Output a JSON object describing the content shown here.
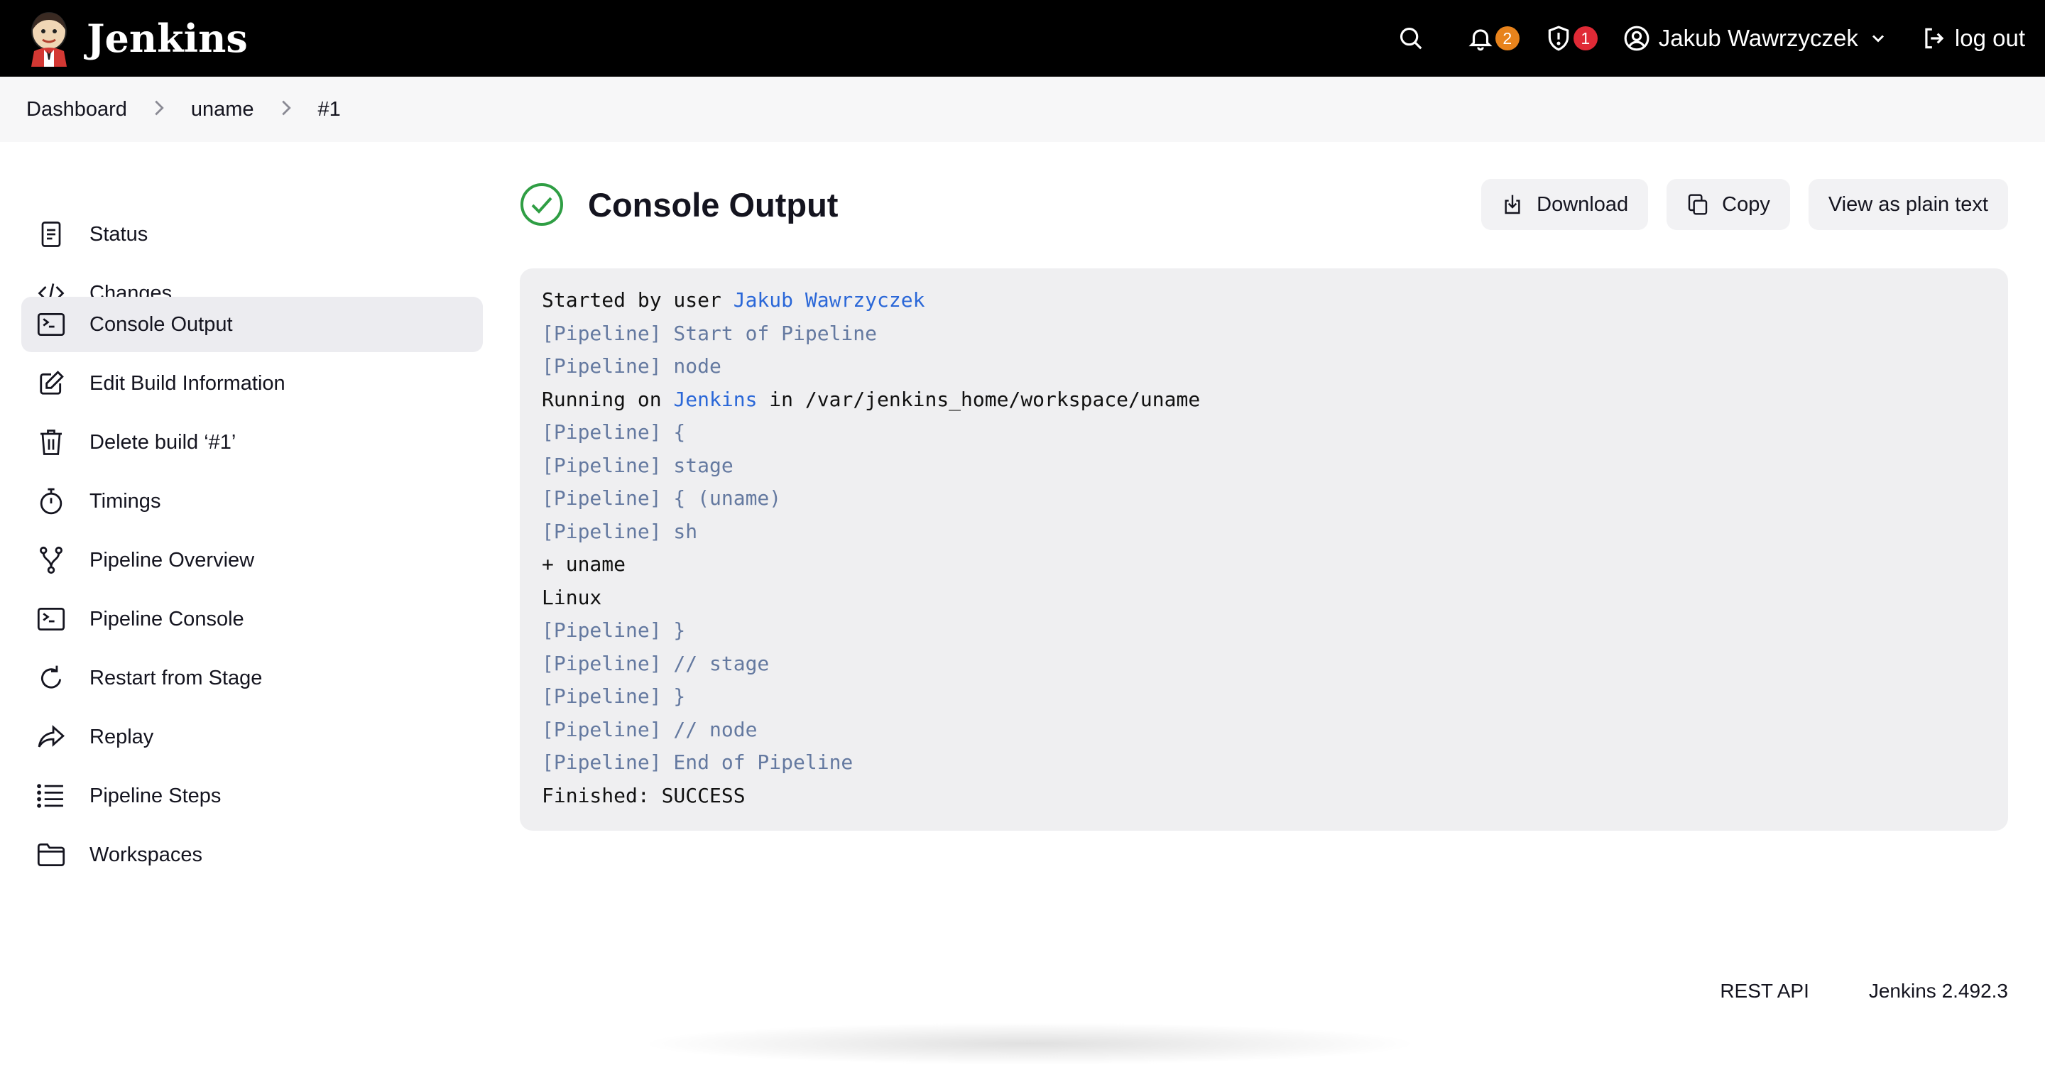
{
  "header": {
    "app_name": "Jenkins",
    "notifications_count": "2",
    "security_count": "1",
    "user_name": "Jakub Wawrzyczek",
    "logout_label": "log out"
  },
  "breadcrumb": [
    "Dashboard",
    "uname",
    "#1"
  ],
  "sidebar": {
    "items": [
      {
        "label": "Status",
        "icon": "document-icon"
      },
      {
        "label": "Changes",
        "icon": "code-icon"
      },
      {
        "label": "Console Output",
        "icon": "terminal-icon",
        "active": true
      },
      {
        "label": "Edit Build Information",
        "icon": "edit-icon"
      },
      {
        "label": "Delete build ‘#1’",
        "icon": "trash-icon"
      },
      {
        "label": "Timings",
        "icon": "stopwatch-icon"
      },
      {
        "label": "Pipeline Overview",
        "icon": "branch-icon"
      },
      {
        "label": "Pipeline Console",
        "icon": "terminal-icon"
      },
      {
        "label": "Restart from Stage",
        "icon": "refresh-icon"
      },
      {
        "label": "Replay",
        "icon": "share-arrow-icon"
      },
      {
        "label": "Pipeline Steps",
        "icon": "list-icon"
      },
      {
        "label": "Workspaces",
        "icon": "folder-icon"
      }
    ]
  },
  "main": {
    "title": "Console Output",
    "status_icon": "success-check-icon",
    "actions": {
      "download": "Download",
      "copy": "Copy",
      "plain_text": "View as plain text"
    },
    "console_lines": [
      {
        "segments": [
          {
            "text": "Started by user ",
            "style": "plain"
          },
          {
            "text": "Jakub Wawrzyczek",
            "style": "link"
          }
        ]
      },
      {
        "segments": [
          {
            "text": "[Pipeline] Start of Pipeline",
            "style": "pipe"
          }
        ]
      },
      {
        "segments": [
          {
            "text": "[Pipeline] node",
            "style": "pipe"
          }
        ]
      },
      {
        "segments": [
          {
            "text": "Running on ",
            "style": "plain"
          },
          {
            "text": "Jenkins",
            "style": "link"
          },
          {
            "text": " in /var/jenkins_home/workspace/uname",
            "style": "plain"
          }
        ]
      },
      {
        "segments": [
          {
            "text": "[Pipeline] {",
            "style": "pipe"
          }
        ]
      },
      {
        "segments": [
          {
            "text": "[Pipeline] stage",
            "style": "pipe"
          }
        ]
      },
      {
        "segments": [
          {
            "text": "[Pipeline] { (uname)",
            "style": "pipe"
          }
        ]
      },
      {
        "segments": [
          {
            "text": "[Pipeline] sh",
            "style": "pipe"
          }
        ]
      },
      {
        "segments": [
          {
            "text": "+ uname",
            "style": "plain"
          }
        ]
      },
      {
        "segments": [
          {
            "text": "Linux",
            "style": "plain"
          }
        ]
      },
      {
        "segments": [
          {
            "text": "[Pipeline] }",
            "style": "pipe"
          }
        ]
      },
      {
        "segments": [
          {
            "text": "[Pipeline] // stage",
            "style": "pipe"
          }
        ]
      },
      {
        "segments": [
          {
            "text": "[Pipeline] }",
            "style": "pipe"
          }
        ]
      },
      {
        "segments": [
          {
            "text": "[Pipeline] // node",
            "style": "pipe"
          }
        ]
      },
      {
        "segments": [
          {
            "text": "[Pipeline] End of Pipeline",
            "style": "pipe"
          }
        ]
      },
      {
        "segments": [
          {
            "text": "Finished: SUCCESS",
            "style": "plain"
          }
        ]
      }
    ]
  },
  "footer": {
    "rest_api": "REST API",
    "version": "Jenkins 2.492.3"
  },
  "colors": {
    "header_bg": "#000000",
    "success_green": "#2f9e44",
    "link_blue": "#2a67d8",
    "pipeline_text": "#6479a0",
    "badge_orange": "#e8831c",
    "badge_red": "#e02a36"
  }
}
